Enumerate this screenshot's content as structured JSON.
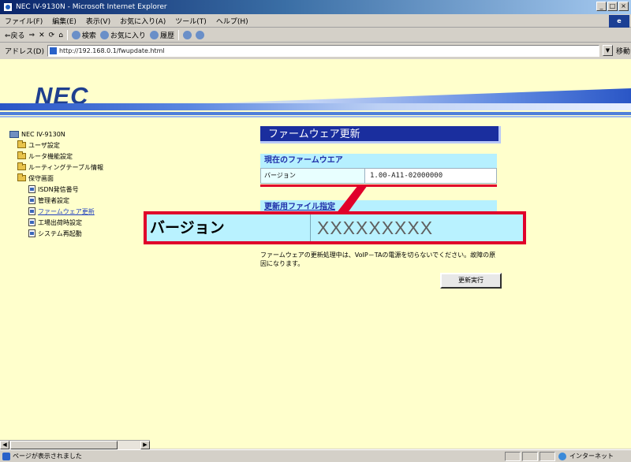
{
  "window": {
    "title": "NEC IV-9130N - Microsoft Internet Explorer",
    "buttons": [
      "_",
      "□",
      "×"
    ]
  },
  "menu": {
    "items": [
      "ファイル(F)",
      "編集(E)",
      "表示(V)",
      "お気に入り(A)",
      "ツール(T)",
      "ヘルプ(H)"
    ]
  },
  "toolbar": {
    "back_label": "⇐戻る",
    "stop_label": "✕",
    "refresh_label": "⟳",
    "home_label": "⌂",
    "search_label": "検索",
    "favorites_label": "お気に入り",
    "history_label": "履歴"
  },
  "address": {
    "label": "アドレス(D)",
    "url": "http://192.168.0.1/fwupdate.html",
    "go_label": "移動"
  },
  "tree": {
    "root": "NEC IV-9130N",
    "items": [
      {
        "label": "ユーザ設定",
        "level": 1,
        "type": "folder"
      },
      {
        "label": "ルータ機能設定",
        "level": 1,
        "type": "folder"
      },
      {
        "label": "ルーティングテーブル情報",
        "level": 1,
        "type": "folder"
      },
      {
        "label": "保守画面",
        "level": 1,
        "type": "folder"
      },
      {
        "label": "ISDN発信番号",
        "level": 2,
        "type": "page"
      },
      {
        "label": "管理者設定",
        "level": 2,
        "type": "page"
      },
      {
        "label": "ファームウェア更新",
        "level": 2,
        "type": "page",
        "active": true
      },
      {
        "label": "工場出荷時設定",
        "level": 2,
        "type": "page"
      },
      {
        "label": "システム再起動",
        "level": 2,
        "type": "page"
      }
    ]
  },
  "main": {
    "title": "ファームウェア更新",
    "current_fw_heading": "現在のファームウエア",
    "version_label": "バージョン",
    "current_version": "1.00-A11-02000000",
    "update_heading": "更新用ファイル指定",
    "callout_label": "バージョン",
    "callout_value": "XXXXXXXXX",
    "notice": "ファームウェアの更新処理中は、VoIP－TAの電源を切らないでください。故障の原因になります。",
    "execute_button": "更新実行"
  },
  "status": {
    "text": "ページが表示されました",
    "zone": "インターネット"
  },
  "colors": {
    "title_bg": "#1a2e9e",
    "section_bg": "#b6f0ff",
    "highlight_red": "#e0002a",
    "page_bg": "#ffffcc"
  }
}
